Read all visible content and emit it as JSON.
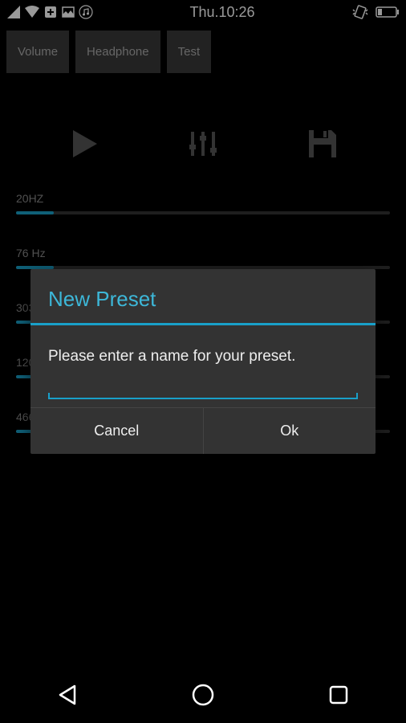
{
  "status": {
    "time": "Thu.10:26"
  },
  "tabs": {
    "volume": "Volume",
    "headphone": "Headphone",
    "test": "Test"
  },
  "eq": {
    "bands": [
      {
        "label": "20HZ",
        "value": 10
      },
      {
        "label": "76 Hz",
        "value": 10
      },
      {
        "label": "303 Hz",
        "value": 10
      },
      {
        "label": "1200",
        "value": 10
      },
      {
        "label": "4666 Hz",
        "value": 50
      }
    ]
  },
  "dialog": {
    "title": "New Preset",
    "body": "Please enter a name for your preset.",
    "cancel": "Cancel",
    "ok": "Ok"
  }
}
